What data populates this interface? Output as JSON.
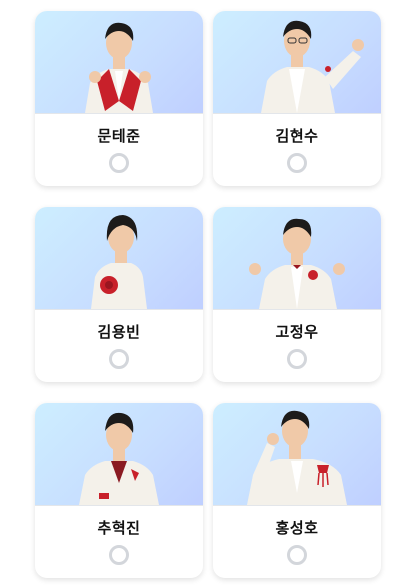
{
  "candidates": [
    {
      "name": "문테준",
      "photo_icon": "person-photo-icon",
      "selected": false
    },
    {
      "name": "김현수",
      "photo_icon": "person-photo-icon",
      "selected": false
    },
    {
      "name": "김용빈",
      "photo_icon": "person-photo-icon",
      "selected": false
    },
    {
      "name": "고정우",
      "photo_icon": "person-photo-icon",
      "selected": false
    },
    {
      "name": "추혁진",
      "photo_icon": "person-photo-icon",
      "selected": false
    },
    {
      "name": "홍성호",
      "photo_icon": "person-photo-icon",
      "selected": false
    }
  ],
  "colors": {
    "photo_bg_start": "#cdeeff",
    "photo_bg_end": "#bfcfff",
    "radio_border": "#d3d6db",
    "name_text": "#111111",
    "suit_white": "#f4f1ea",
    "accent_red": "#c8202a"
  }
}
